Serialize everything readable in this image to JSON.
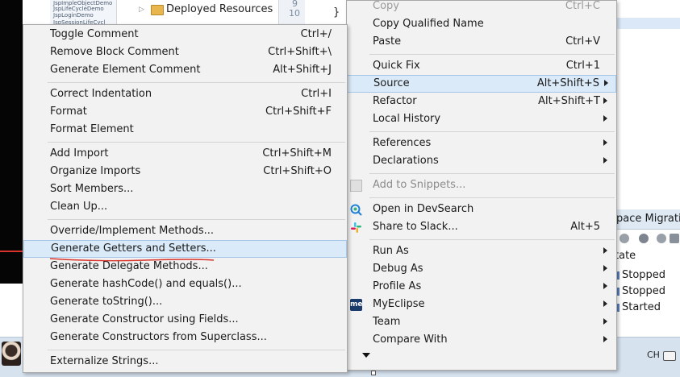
{
  "background": {
    "tree_items": [
      "JspImpleObjectDemo",
      "JspLifeCycleDemo",
      "JspLoginDemo",
      "JspSessionLifeCycl"
    ],
    "deployed_label": "Deployed Resources",
    "editor": {
      "line9": "9",
      "line10": "10",
      "brace": "}"
    },
    "servers": {
      "title": "pace Migration",
      "column": "tate",
      "rows": [
        "Stopped",
        "Stopped",
        "Started"
      ]
    },
    "taskbar": {
      "ime": "CH"
    }
  },
  "main_menu": {
    "items": [
      {
        "label": "Copy",
        "shortcut": "Ctrl+C",
        "state": "faded"
      },
      {
        "label": "Copy Qualified Name",
        "shortcut": ""
      },
      {
        "label": "Paste",
        "shortcut": "Ctrl+V"
      },
      {
        "label": "Quick Fix",
        "shortcut": "Ctrl+1"
      },
      {
        "label": "Source",
        "shortcut": "Alt+Shift+S",
        "submenu": true,
        "state": "hover"
      },
      {
        "label": "Refactor",
        "shortcut": "Alt+Shift+T",
        "submenu": true
      },
      {
        "label": "Local History",
        "shortcut": "",
        "submenu": true
      },
      {
        "label": "References",
        "shortcut": "",
        "submenu": true
      },
      {
        "label": "Declarations",
        "shortcut": "",
        "submenu": true
      },
      {
        "label": "Add to Snippets...",
        "shortcut": "",
        "state": "disabled"
      },
      {
        "label": "Open in DevSearch",
        "shortcut": ""
      },
      {
        "label": "Share to Slack...",
        "shortcut": "Alt+5"
      },
      {
        "label": "Run As",
        "shortcut": "",
        "submenu": true
      },
      {
        "label": "Debug As",
        "shortcut": "",
        "submenu": true
      },
      {
        "label": "Profile As",
        "shortcut": "",
        "submenu": true
      },
      {
        "label": "MyEclipse",
        "shortcut": "",
        "submenu": true
      },
      {
        "label": "Team",
        "shortcut": "",
        "submenu": true
      },
      {
        "label": "Compare With",
        "shortcut": "",
        "submenu": true
      }
    ],
    "myeclipse_icon_text": "me"
  },
  "source_menu": {
    "items": [
      {
        "label": "Toggle Comment",
        "shortcut": "Ctrl+/"
      },
      {
        "label": "Remove Block Comment",
        "shortcut": "Ctrl+Shift+\\"
      },
      {
        "label": "Generate Element Comment",
        "shortcut": "Alt+Shift+J"
      },
      {
        "label": "Correct Indentation",
        "shortcut": "Ctrl+I"
      },
      {
        "label": "Format",
        "shortcut": "Ctrl+Shift+F"
      },
      {
        "label": "Format Element",
        "shortcut": ""
      },
      {
        "label": "Add Import",
        "shortcut": "Ctrl+Shift+M"
      },
      {
        "label": "Organize Imports",
        "shortcut": "Ctrl+Shift+O"
      },
      {
        "label": "Sort Members...",
        "shortcut": ""
      },
      {
        "label": "Clean Up...",
        "shortcut": ""
      },
      {
        "label": "Override/Implement Methods...",
        "shortcut": ""
      },
      {
        "label": "Generate Getters and Setters...",
        "shortcut": "",
        "state": "hover"
      },
      {
        "label": "Generate Delegate Methods...",
        "shortcut": ""
      },
      {
        "label": "Generate hashCode() and equals()...",
        "shortcut": ""
      },
      {
        "label": "Generate toString()...",
        "shortcut": ""
      },
      {
        "label": "Generate Constructor using Fields...",
        "shortcut": ""
      },
      {
        "label": "Generate Constructors from Superclass...",
        "shortcut": ""
      },
      {
        "label": "Externalize Strings...",
        "shortcut": ""
      }
    ]
  },
  "colors": {
    "menu_bg": "#f2f2f2",
    "hover_bg": "#dbeaf8",
    "annotation_red": "#d9342b",
    "myeclipse_icon": "#1b3b6a"
  }
}
